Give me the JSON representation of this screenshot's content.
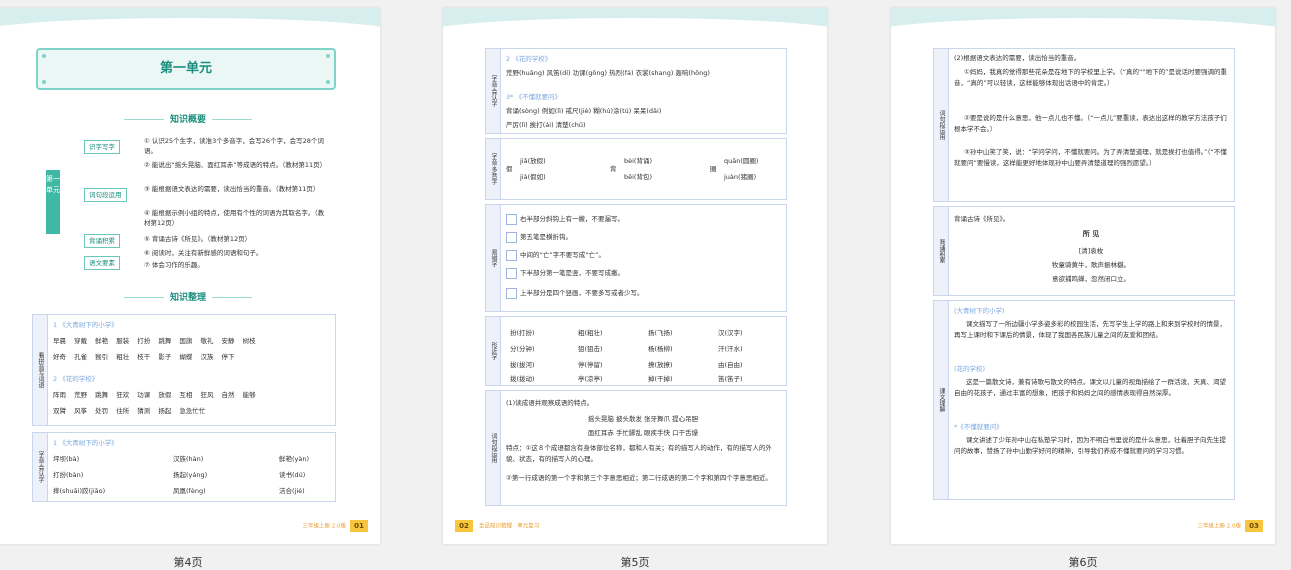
{
  "captions": [
    "第4页",
    "第5页",
    "第6页"
  ],
  "page1": {
    "unit_title": "第一单元",
    "overview_title": "知识概要",
    "unit_side": "第一单元",
    "tags": [
      "识字写字",
      "词句段运用",
      "背诵积累",
      "语文要素"
    ],
    "items": [
      "① 认识25个生字，读准3个多音字，会写26个字，会写28个词语。",
      "② 能说出“摇头晃脑、面红耳赤”等成语的特点。（教材第11页）",
      "③ 能根据语文表达的需要，读出恰当的重音。（教材第11页）",
      "④ 能根据示例小组的特点，使用有个性的词语为其取名字。（教材第12页）",
      "⑤ 背诵古诗《所见》。（教材第12页）",
      "⑥ 阅读时，关注有新鲜感的词语和句子。",
      "⑦ 体会习作的乐趣。"
    ],
    "organize_title": "知识整理",
    "table1_side": "看拼音写词语",
    "table1": {
      "lesson1": "1 《大青树下的小学》",
      "row1": "早晨 穿戴 鲜艳 服装 打扮 跳舞 国旗 敬礼 安静 树枝",
      "row2": "好奇 孔雀 猴引 粗壮 枝干 影子 蝴蝶 汉族 停下",
      "lesson2": "2 《花的学校》",
      "row3": "阵雨 荒野 跳舞 狂欢 功课 放假 互相 狂风 自然 能够",
      "row4": "双臂 风筝 处罚 住所 猜测 扬起 急急忙忙"
    },
    "table2_side": "字音·会认字",
    "table2": {
      "lesson1": "1 《大青树下的小学》",
      "c1": [
        "坪坝(bà)",
        "打扮(bàn)",
        "摔(shuāi)跤(jiāo)"
      ],
      "c2": [
        "汉族(hàn)",
        "扬起(yáng)",
        "凤凰(fèng)"
      ],
      "c3": [
        "鲜艳(yàn)",
        "读书(dú)",
        "洁合(jié)"
      ]
    },
    "footer": "三年级上册 2.0版",
    "page_num": "01"
  },
  "page2": {
    "b1_side": "字音·会认字",
    "b1": {
      "lesson2": "2 《花的学校》",
      "row1": "荒野(huāng) 风笛(dí) 功课(gōng) 热烈(fá) 衣裳(shang) 轰响(hōng)",
      "lesson3": "3* 《不懂就要问》",
      "row2": "背诵(sòng) 例如(lì) 戒尺(jiè) 糊(hú)涂(tú) 呆呆(dāi)",
      "row3": "严厉(lì) 挨打(ái) 清楚(chǔ)"
    },
    "b2_side": "字音·多音字",
    "b2": {
      "g1": "假",
      "g1a": "jiǎ(放假)",
      "g1b": "jià(假如)",
      "g2": "背",
      "g2a": "bèi(背诵)",
      "g2b": "bēi(背包)",
      "g3": "圈",
      "g3a": "quān(圆圈)",
      "g3b": "juàn(猪圈)"
    },
    "b3_side": "易错字",
    "b3": [
      "右半部分斜钩上有一撇，不要漏写。",
      "第五笔是横折钩。",
      "中间的“亡”字不要写成“亡”。",
      "下半部分第一笔是竖，不要写成撇。",
      "上半部分是四个竖画，不要多写或者少写。"
    ],
    "b4_side": "形近字",
    "b4": [
      [
        "扮(打扮)",
        "分(分钟)"
      ],
      [
        "粗(粗壮)",
        "狙(狙击)"
      ],
      [
        "扬(飞扬)",
        "杨(杨柳)"
      ],
      [
        "汉(汉字)",
        "汗(汗水)"
      ],
      [
        "拔(拔河)",
        "拨(拨动)"
      ],
      [
        "停(停留)",
        "亭(凉亭)"
      ],
      [
        "撩(放撩)",
        "掉(干掉)"
      ],
      [
        "由(自由)",
        "笛(笛子)"
      ]
    ],
    "b5_side": "词句段运用",
    "b5": {
      "q": "(1)读成语并观察成语的特点。",
      "idioms1": "摇头晃脑   披头散发   张牙舞爪   提心吊胆",
      "idioms2": "面红耳赤   手忙脚乱   眼疾手快   口干舌燥",
      "feature": "特点：①这８个成语都含有身体部位名称，都和人有关；有的描写人的动作，有的描写人的外貌、状态，有的描写人的心理。",
      "feature2": "②第一行成语的第一个字和第三个字意思相近；第二行成语的第二个字和第四个字意思相近。"
    },
    "footer": "全品知识梳理 · 单元复习",
    "page_num": "02"
  },
  "page3": {
    "b1_side": "词句段运用",
    "b1": [
      "(2)根据语文表达的需要，读出恰当的重音。",
      "①妈妈，我真的觉得那些花朵是在地下的学校里上学。（“真的”“地下的”是说话时要强调的重音，“真的”可以轻读，这样能够体现出话语中的肯定。）",
      "②要是说的是什么意思，他一点儿也不懂。（“一点儿”要重读，表达出这样的教学方法孩子们根本学不会。）",
      "③孙中山笑了笑，说：“学问学问，不懂就要问。为了弄清楚道理，就是挨打也值得。”（“不懂就要问”要慢读，这样能更好地体现孙中山要弄清楚道理的强烈愿望。）"
    ],
    "b2_side": "背诵积累",
    "b2": {
      "intro": "背诵古诗《所见》。",
      "poem_title": "所 见",
      "author": "[清]袁枚",
      "line1": "牧童骑黄牛，歌声振林樾。",
      "line2": "意欲捕鸣蝉，忽然闭口立。"
    },
    "b3_side": "课文理解",
    "b3": {
      "l1": "(大青树下的小学)",
      "p1": "课文描写了一所边疆小学多姿多彩的校园生活，先写学生上学的路上和来到学校时的情景，再写上课时和下课后的情景，体现了我国各民族儿童之间的友爱和团结。",
      "l2": "(花的学校)",
      "p2": "这是一篇散文诗，兼有诗歌与散文的特点。课文以儿童的视角描绘了一群活泼、天真、渴望自由的花孩子，通过丰富的想象，把孩子和妈妈之间的感情表现得自然深厚。",
      "l3": "*《不懂就要问》",
      "p3": "课文讲述了少年孙中山在私塾学习时，因为不明白书里说的是什么意思，壮着胆子向先生提问的故事，赞扬了孙中山勤学好问的精神，引导我们养成不懂就要问的学习习惯。"
    },
    "footer": "三年级上册 2.0版",
    "page_num": "03"
  }
}
